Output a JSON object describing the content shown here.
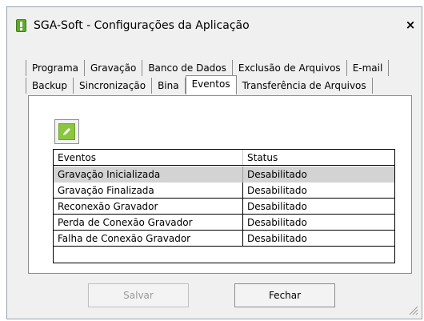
{
  "window": {
    "title": "SGA-Soft - Configurações da Aplicação",
    "close_label": "×"
  },
  "tabs": {
    "row1": [
      "Programa",
      "Gravação",
      "Banco de Dados",
      "Exclusão de Arquivos",
      "E-mail"
    ],
    "row2": [
      "Backup",
      "Sincronização",
      "Bina",
      "Eventos",
      "Transferência de Arquivos"
    ],
    "active": "Eventos"
  },
  "toolbar": {
    "edit_icon": "pencil-icon"
  },
  "grid": {
    "columns": [
      "Eventos",
      "Status"
    ],
    "rows": [
      [
        "Gravação Inicializada",
        "Desabilitado"
      ],
      [
        "Gravação Finalizada",
        "Desabilitado"
      ],
      [
        "Reconexão Gravador",
        "Desabilitado"
      ],
      [
        "Perda de Conexão Gravador",
        "Desabilitado"
      ],
      [
        "Falha de Conexão Gravador",
        "Desabilitado"
      ]
    ],
    "selected_index": 0
  },
  "buttons": {
    "save_label": "Salvar",
    "close_label": "Fechar"
  },
  "colors": {
    "accent_green": "#8cc63f",
    "selection_gray": "#d3d3d3"
  }
}
